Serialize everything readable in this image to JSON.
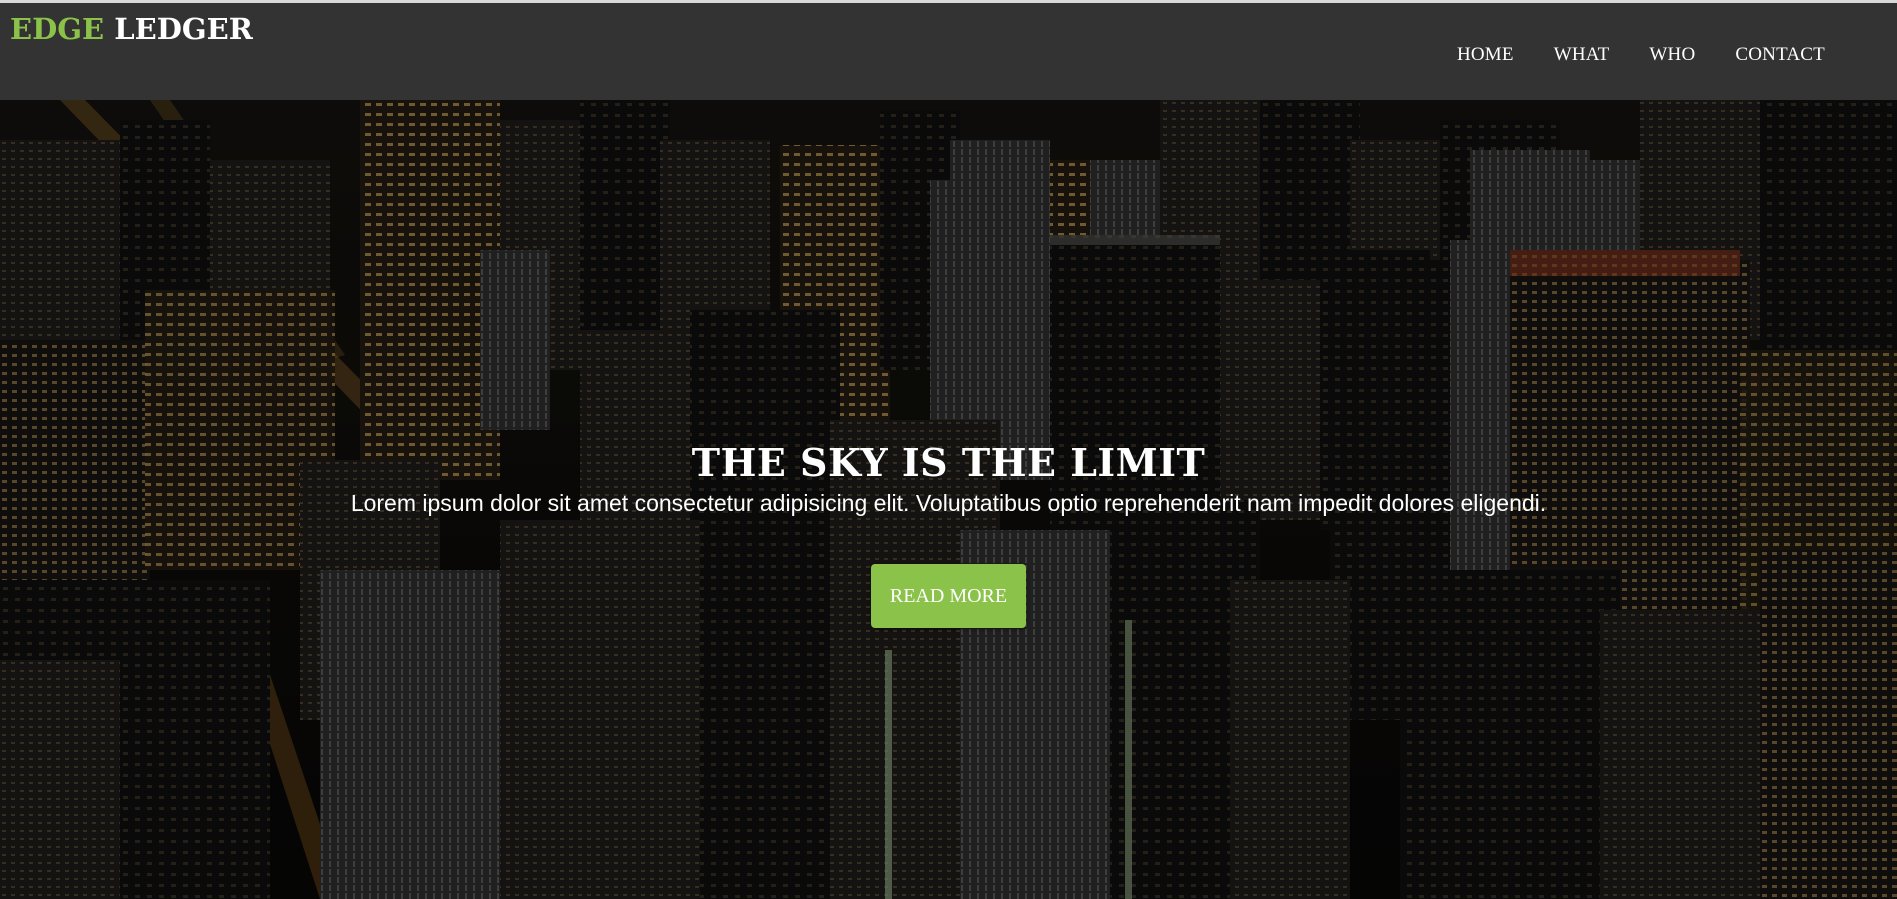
{
  "brand": {
    "accent_word": "EDGE",
    "rest_word": " LEDGER",
    "accent_color": "#8bc34a"
  },
  "nav": {
    "items": [
      {
        "label": "HOME"
      },
      {
        "label": "WHAT"
      },
      {
        "label": "WHO"
      },
      {
        "label": "CONTACT"
      }
    ]
  },
  "hero": {
    "title": "THE SKY IS THE LIMIT",
    "subtitle": "Lorem ipsum dolor sit amet consectetur adipisicing elit. Voluptatibus optio reprehenderit nam impedit dolores eligendi.",
    "button_label": "READ MORE",
    "button_color": "#8bc34a"
  },
  "colors": {
    "navbar_bg": "#333333",
    "text": "#ffffff"
  }
}
